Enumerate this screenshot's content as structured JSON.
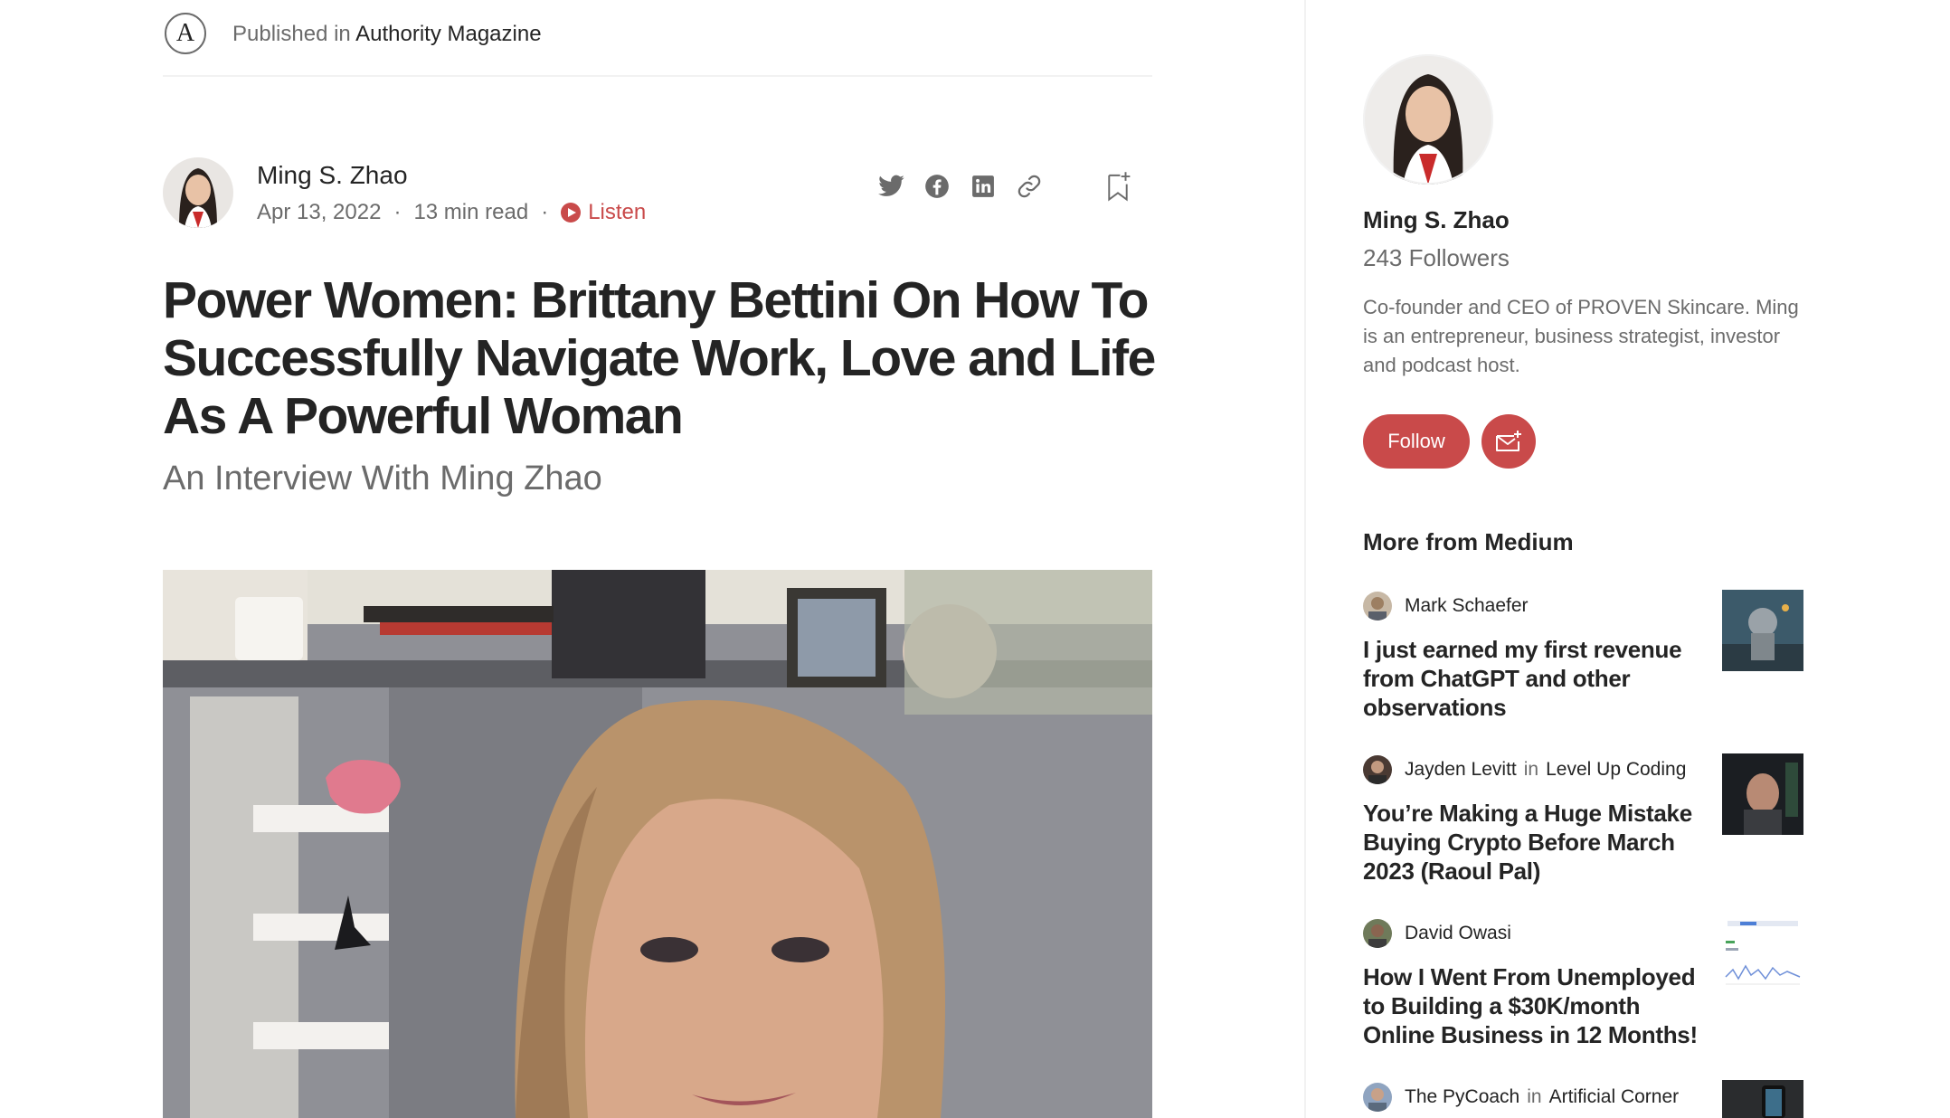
{
  "publication": {
    "prefix": "Published in",
    "name": "Authority Magazine",
    "logo_letter": "A"
  },
  "article": {
    "author": "Ming S. Zhao",
    "date": "Apr 13, 2022",
    "read_time": "13 min read",
    "separator": "·",
    "listen_label": "Listen",
    "title": "Power Women: Brittany Bettini On How To Successfully Navigate Work, Love and Life As A Powerful Woman",
    "subtitle": "An Interview With Ming Zhao",
    "share_icons": [
      "twitter-icon",
      "facebook-icon",
      "linkedin-icon",
      "link-icon",
      "bookmark-add-icon"
    ]
  },
  "sidebar": {
    "author_name": "Ming S. Zhao",
    "followers": "243 Followers",
    "bio": "Co-founder and CEO of PROVEN Skincare. Ming is an entrepreneur, business strategist, investor and podcast host.",
    "follow_label": "Follow",
    "more_heading": "More from Medium",
    "recommendations": [
      {
        "author": "Mark Schaefer",
        "in": "",
        "publication": "",
        "title": "I just earned my first revenue from ChatGPT and other observations"
      },
      {
        "author": "Jayden Levitt",
        "in": "in",
        "publication": "Level Up Coding",
        "title": "You’re Making a Huge Mistake Buying Crypto Before March 2023 (Raoul Pal)"
      },
      {
        "author": "David Owasi",
        "in": "",
        "publication": "",
        "title": "How I Went From Unemployed to Building a $30K/month Online Business in 12 Months!"
      },
      {
        "author": "The PyCoach",
        "in": "in",
        "publication": "Artificial Corner",
        "title": ""
      }
    ]
  },
  "colors": {
    "accent": "#c94a4a",
    "text": "#242424",
    "muted": "#6b6b6b",
    "divider": "#f2f2f2"
  }
}
